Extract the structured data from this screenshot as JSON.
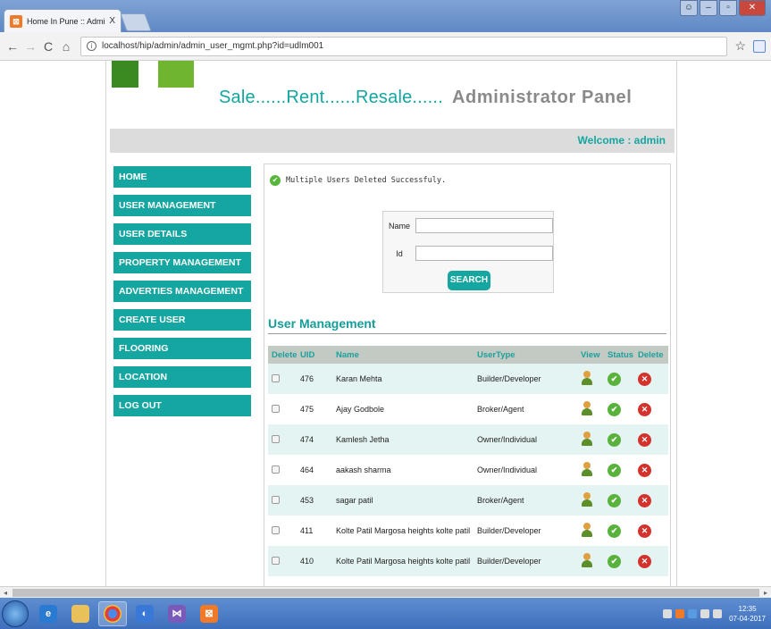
{
  "browser": {
    "tab_title": "Home In Pune :: Administ",
    "tab_close": "X",
    "url": "localhost/hip/admin/admin_user_mgmt.php?id=udlm001"
  },
  "header": {
    "title_main": "Sale......Rent......Resale......",
    "title_admin": "Administrator Panel",
    "welcome": "Welcome :  admin"
  },
  "sidebar": {
    "items": [
      {
        "label": "HOME"
      },
      {
        "label": "USER MANAGEMENT"
      },
      {
        "label": "USER DETAILS"
      },
      {
        "label": "PROPERTY MANAGEMENT"
      },
      {
        "label": "ADVERTIES MANAGEMENT"
      },
      {
        "label": "CREATE USER"
      },
      {
        "label": "FLOORING"
      },
      {
        "label": "LOCATION"
      },
      {
        "label": "LOG OUT"
      }
    ]
  },
  "message": "Multiple Users Deleted Successfuly.",
  "search": {
    "name_label": "Name",
    "id_label": "Id",
    "name_value": "",
    "id_value": "",
    "button": "SEARCH"
  },
  "section_title": "User Management",
  "table": {
    "headers": [
      "Delete",
      "UID",
      "Name",
      "UserType",
      "View",
      "Status",
      "Delete"
    ],
    "rows": [
      {
        "uid": "476",
        "name": "Karan Mehta",
        "type": "Builder/Developer"
      },
      {
        "uid": "475",
        "name": "Ajay Godbole",
        "type": "Broker/Agent"
      },
      {
        "uid": "474",
        "name": "Kamlesh Jetha",
        "type": "Owner/Individual"
      },
      {
        "uid": "464",
        "name": "aakash sharma",
        "type": "Owner/Individual"
      },
      {
        "uid": "453",
        "name": "sagar patil",
        "type": "Broker/Agent"
      },
      {
        "uid": "411",
        "name": "Kolte Patil Margosa heights kolte patil",
        "type": "Builder/Developer"
      },
      {
        "uid": "410",
        "name": "Kolte Patil Margosa heights kolte patil",
        "type": "Builder/Developer"
      }
    ]
  },
  "taskbar": {
    "time": "12:35",
    "date": "07-04-2017"
  },
  "colors": {
    "accent": "#16a6a1",
    "row_alt": "#e4f4f3",
    "header_bg": "#c3c9c3",
    "status_ok": "#58b23c",
    "delete_red": "#d4322c"
  }
}
